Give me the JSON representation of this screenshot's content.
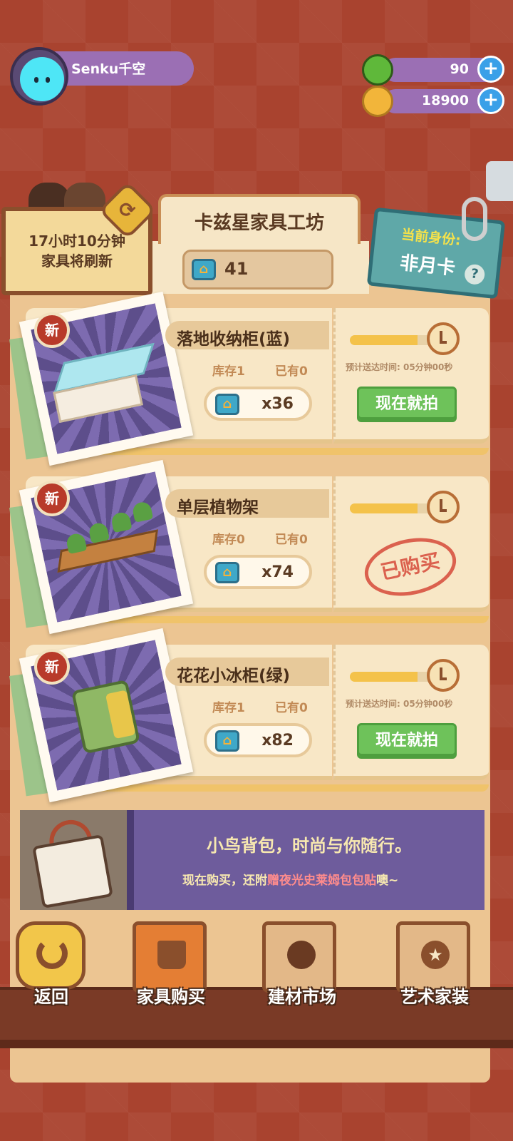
{
  "player": {
    "name": "Senku千空"
  },
  "currencies": [
    {
      "value": "90",
      "color": "#5fb83a"
    },
    {
      "value": "18900",
      "color": "#f2b53a"
    }
  ],
  "shop": {
    "timer_line1": "17小时10分钟",
    "timer_line2": "家具将刷新",
    "title": "卡兹星家具工坊",
    "ticket_count": "41",
    "identity_label": "当前身份:",
    "identity_value": "非月卡",
    "help": "?"
  },
  "items": [
    {
      "badge": "新",
      "name": "落地收纳柜(蓝)",
      "stock": "库存1",
      "owned": "已有0",
      "price": "x36",
      "eta": "预计送达时间: 05分钟00秒",
      "action": "现在就拍",
      "purchased": false,
      "progress": 0.75
    },
    {
      "badge": "新",
      "name": "单层植物架",
      "stock": "库存0",
      "owned": "已有0",
      "price": "x74",
      "status": "已购买",
      "purchased": true,
      "progress": 0.75
    },
    {
      "badge": "新",
      "name": "花花小冰柜(绿)",
      "stock": "库存1",
      "owned": "已有0",
      "price": "x82",
      "eta": "预计送达时间: 05分钟00秒",
      "action": "现在就拍",
      "purchased": false,
      "progress": 0.75
    }
  ],
  "banner": {
    "headline": "小鸟背包，时尚与你随行。",
    "sub_prefix": "现在购买，还附",
    "sub_highlight": "赠夜光史莱姆包包贴",
    "sub_suffix": "噢~"
  },
  "nav": [
    {
      "label": "返回",
      "icon": "back-arrow-icon"
    },
    {
      "label": "家具购买",
      "icon": "potted-plant-icon",
      "active": true
    },
    {
      "label": "建材市场",
      "icon": "paint-bucket-icon"
    },
    {
      "label": "艺术家装",
      "icon": "star-medal-icon"
    }
  ]
}
